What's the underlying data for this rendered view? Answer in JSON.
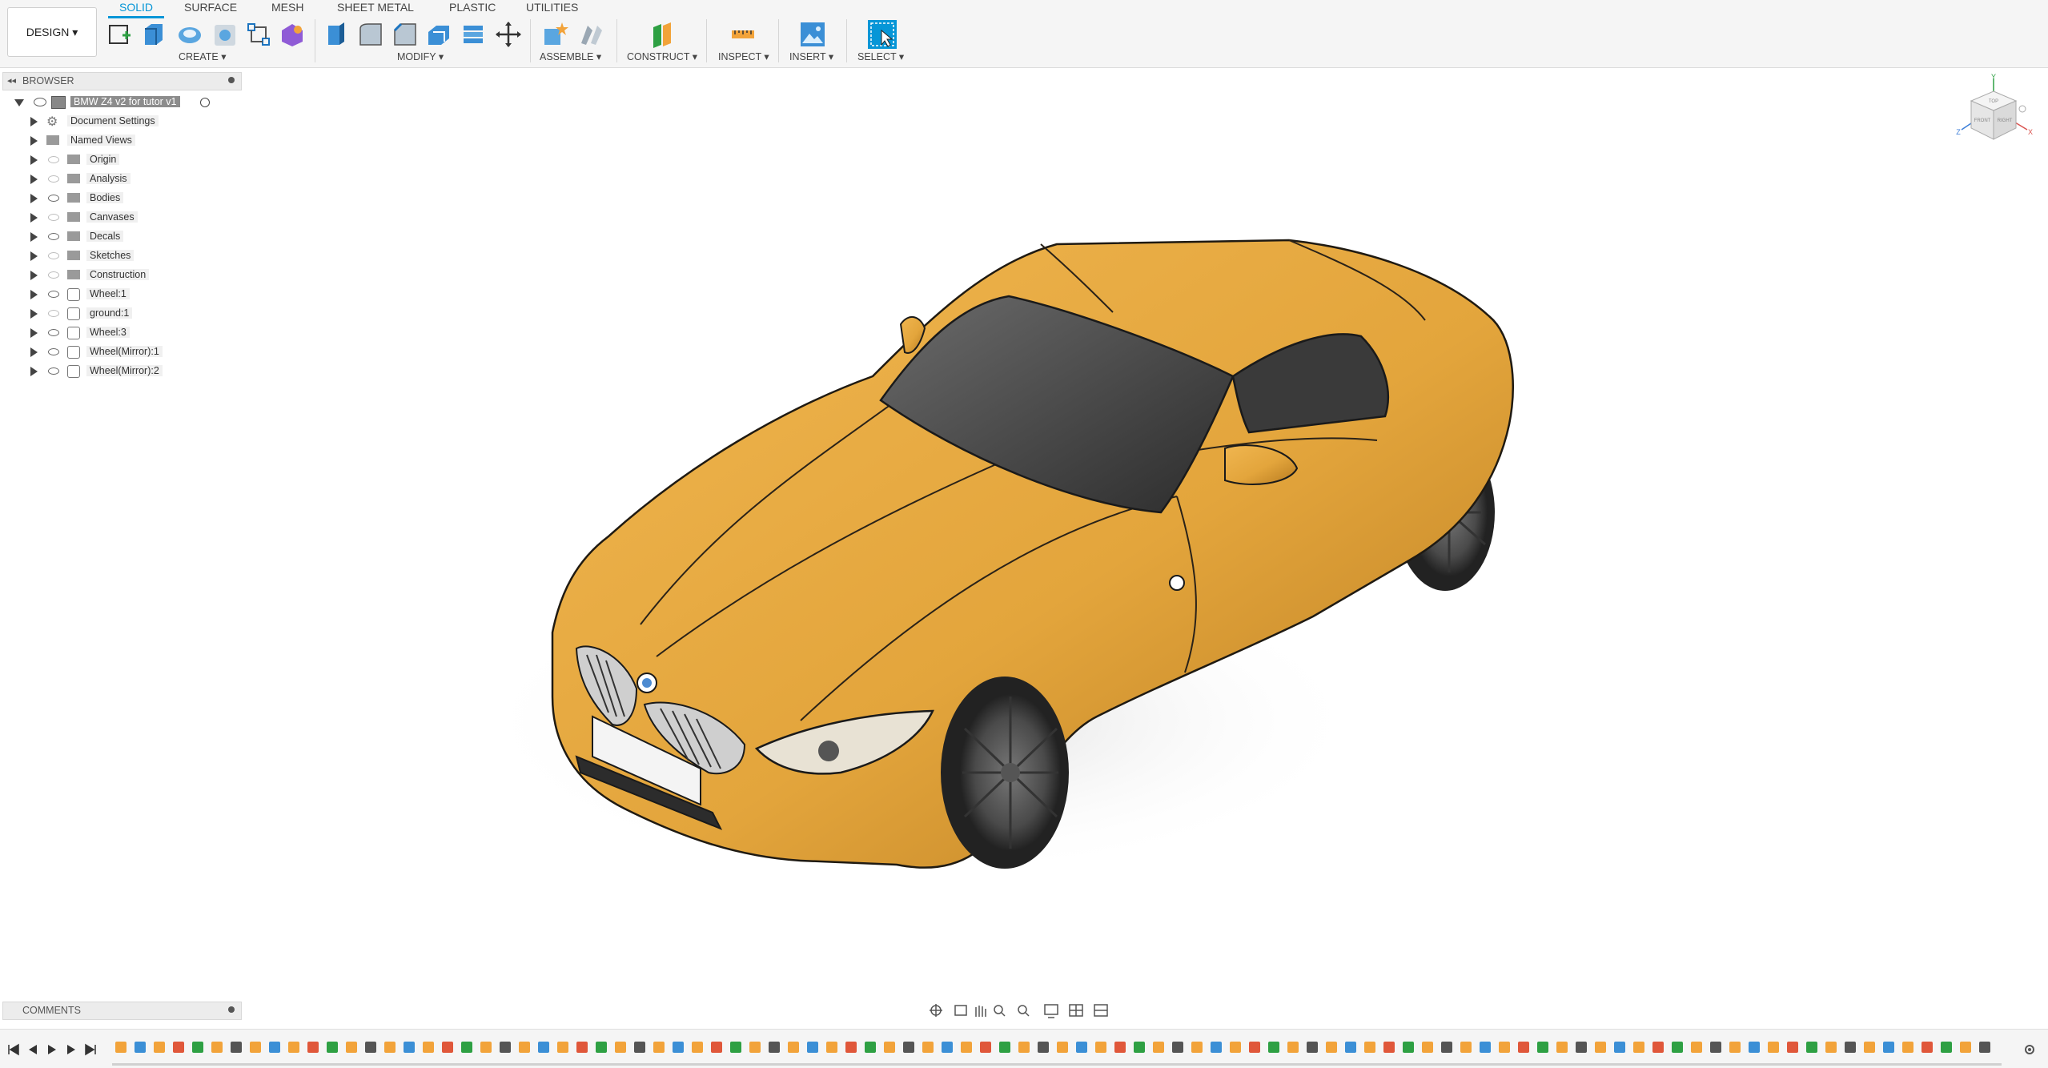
{
  "toolbar": {
    "workspace": "DESIGN ▾",
    "tabs": [
      "SOLID",
      "SURFACE",
      "MESH",
      "SHEET METAL",
      "PLASTIC",
      "UTILITIES"
    ],
    "groups": {
      "create": "CREATE ▾",
      "modify": "MODIFY ▾",
      "assemble": "ASSEMBLE ▾",
      "construct": "CONSTRUCT ▾",
      "inspect": "INSPECT ▾",
      "insert": "INSERT ▾",
      "select": "SELECT ▾"
    },
    "accent": "#0696d7"
  },
  "browser": {
    "title": "BROWSER",
    "root": "BMW Z4 v2 for tutor v1",
    "items": [
      "Document Settings",
      "Named Views",
      "Origin",
      "Analysis",
      "Bodies",
      "Canvases",
      "Decals",
      "Sketches",
      "Construction",
      "Wheel:1",
      "ground:1",
      "Wheel:3",
      "Wheel(Mirror):1",
      "Wheel(Mirror):2"
    ]
  },
  "viewcube": {
    "top": "TOP",
    "front": "FRONT",
    "right": "RIGHT",
    "axis_x": "X",
    "axis_y": "Y",
    "axis_z": "Z"
  },
  "comments": {
    "title": "COMMENTS"
  },
  "model": {
    "body_color": "#e3a53c",
    "body_shadow": "#b77a1f",
    "glass_color": "#3c3c3c"
  }
}
